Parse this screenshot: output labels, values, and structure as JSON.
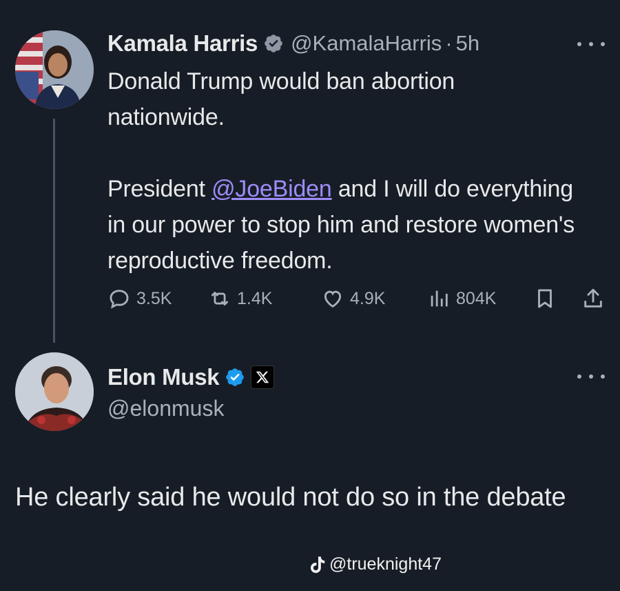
{
  "tweet1": {
    "display_name": "Kamala Harris",
    "handle": "@KamalaHarris",
    "separator": "·",
    "time": "5h",
    "text_line1": "Donald Trump would ban abortion nationwide.",
    "text_p2_before": "President ",
    "text_p2_mention": "@JoeBiden",
    "text_p2_after": " and I will do everything in our power to stop him and restore women's reproductive freedom.",
    "stats": {
      "replies": "3.5K",
      "reposts": "1.4K",
      "likes": "4.9K",
      "views": "804K"
    },
    "icons": [
      "verified-badge-icon",
      "more-icon",
      "reply-icon",
      "repost-icon",
      "like-icon",
      "views-icon",
      "bookmark-icon",
      "share-icon"
    ]
  },
  "tweet2": {
    "display_name": "Elon Musk",
    "handle": "@elonmusk",
    "text": "He clearly said he would not do so in the debate",
    "icons": [
      "verified-badge-icon",
      "x-logo-icon",
      "more-icon"
    ]
  },
  "watermark": {
    "text": "@trueknight47",
    "icon": "tiktok-icon"
  },
  "colors": {
    "background": "#171d26",
    "text": "#e7e9ea",
    "muted": "#a8b0ba",
    "mention": "#9d8cf8",
    "verified": "#1d9bf0"
  }
}
